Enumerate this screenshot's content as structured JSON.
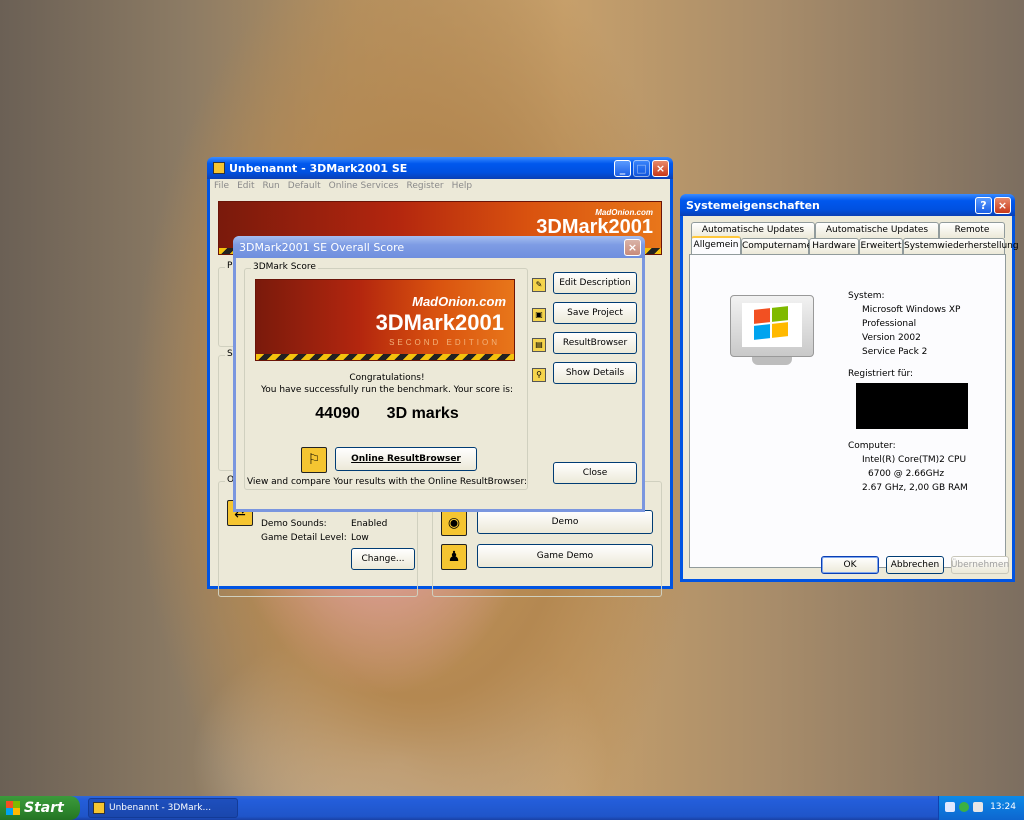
{
  "main_window": {
    "title": "Unbenannt - 3DMark2001 SE",
    "menu": [
      "File",
      "Edit",
      "Run",
      "Default",
      "Online Services",
      "Register",
      "Help"
    ],
    "banner_brand": "3DMark2001",
    "banner_sub": "MadOnion.com",
    "section_labels": [
      "Pr",
      "Se",
      "Op"
    ],
    "demo_sounds_label": "Demo Sounds:",
    "demo_sounds_value": "Enabled",
    "game_detail_label": "Game Detail Level:",
    "game_detail_value": "Low",
    "change_button": "Change...",
    "demo_button": "Demo",
    "game_demo_button": "Game Demo"
  },
  "score_dialog": {
    "title": "3DMark2001 SE Overall Score",
    "group_label": "3DMark Score",
    "logo_brand": "3DMark2001",
    "logo_madonion": "MadOnion.com",
    "logo_edition": "SECOND EDITION",
    "congrats": "Congratulations!",
    "success_msg": "You have successfully run the benchmark. Your score is:",
    "score_value": "44090",
    "score_unit": "3D marks",
    "online_button": "Online ResultBrowser",
    "online_caption": "View and compare Your results with the Online ResultBrowser:",
    "edit_desc_button": "Edit Description",
    "save_project_button": "Save Project",
    "result_browser_button": "ResultBrowser",
    "show_details_button": "Show Details",
    "close_button": "Close"
  },
  "sys_props": {
    "title": "Systemeigenschaften",
    "tabs_top": [
      "Automatische Updates",
      "Automatische Updates",
      "Remote"
    ],
    "tabs_bottom": [
      "Allgemein",
      "Computername",
      "Hardware",
      "Erweitert",
      "Systemwiederherstellung"
    ],
    "system_label": "System:",
    "system_lines": [
      "Microsoft Windows XP",
      "Professional",
      "Version 2002",
      "Service Pack 2"
    ],
    "registered_label": "Registriert für:",
    "computer_label": "Computer:",
    "computer_lines": [
      "Intel(R) Core(TM)2 CPU",
      "6700  @ 2.66GHz",
      "2.67 GHz, 2,00 GB RAM"
    ],
    "ok_button": "OK",
    "cancel_button": "Abbrechen",
    "apply_button": "Übernehmen"
  },
  "taskbar": {
    "start_label": "Start",
    "task_label": "Unbenannt - 3DMark...",
    "clock": "13:24"
  }
}
